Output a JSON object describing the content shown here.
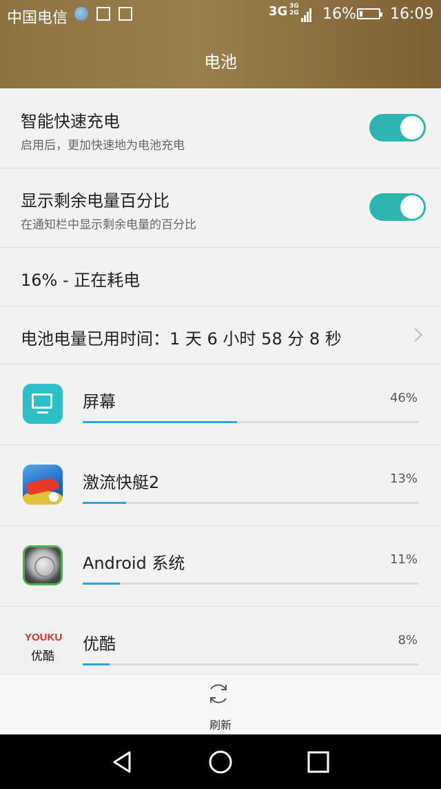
{
  "status_bar": {
    "carrier": "中国电信",
    "net_primary": "3G",
    "net_secondary_top": "3G",
    "net_secondary_bottom": "2G",
    "battery_percent": "16%",
    "time": "16:09"
  },
  "header": {
    "title": "电池"
  },
  "settings": {
    "fast_charge": {
      "title": "智能快速充电",
      "subtitle": "启用后，更加快速地为电池充电",
      "enabled": true
    },
    "show_percent": {
      "title": "显示剩余电量百分比",
      "subtitle": "在通知栏中显示剩余电量的百分比",
      "enabled": true
    },
    "battery_state": "16% - 正在耗电",
    "usage_time": "电池电量已用时间：1 天 6 小时 58 分 8 秒"
  },
  "apps": [
    {
      "name": "屏幕",
      "percent_label": "46%",
      "percent": 46,
      "icon": "screen-icon"
    },
    {
      "name": "激流快艇2",
      "percent_label": "13%",
      "percent": 13,
      "icon": "riptide-game-icon"
    },
    {
      "name": "Android 系统",
      "percent_label": "11%",
      "percent": 11,
      "icon": "android-system-icon"
    },
    {
      "name": "优酷",
      "percent_label": "8%",
      "percent": 8,
      "icon": "youku-icon",
      "icon_text_top": "YOUKU",
      "icon_text_bottom": "优酷"
    }
  ],
  "footer": {
    "refresh_label": "刷新"
  },
  "colors": {
    "accent": "#2fb5b1",
    "bar": "#2ba3dc",
    "header": "#8c7441"
  }
}
